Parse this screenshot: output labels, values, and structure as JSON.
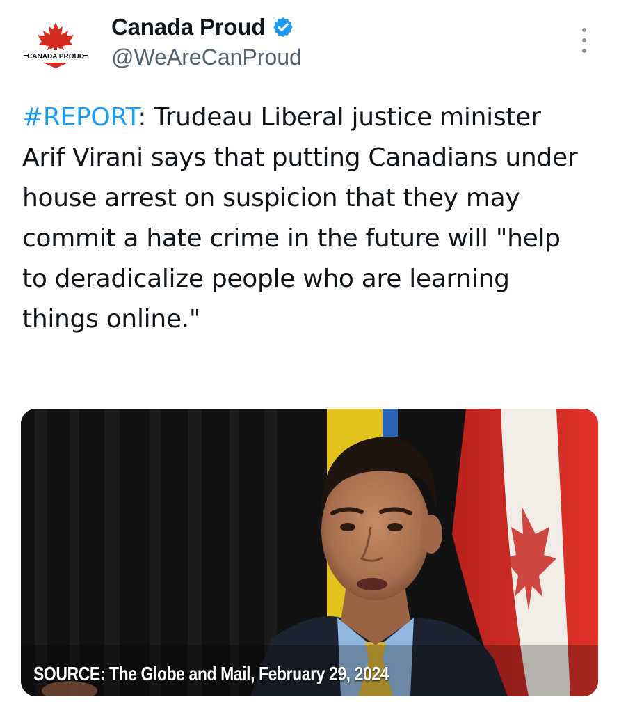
{
  "account": {
    "display_name": "Canada Proud",
    "handle": "@WeAreCanProud",
    "avatar_text": "CANADA PROUD",
    "verified": true
  },
  "tweet": {
    "hashtag": "#REPORT",
    "text": ": Trudeau Liberal justice minister Arif Virani says that putting Canadians under house arrest on suspicion that they may commit a hate crime in the future will \"help to deradicalize people who are learning things online.\""
  },
  "media": {
    "caption": "SOURCE: The Globe and Mail, February 29, 2024"
  },
  "colors": {
    "accent": "#1d9bf0",
    "text": "#0f1419",
    "muted": "#536471",
    "brand_red": "#d52b1e"
  },
  "icons": {
    "verified": "verified-badge-icon",
    "more": "more-options-icon",
    "avatar": "maple-leaf-icon"
  }
}
